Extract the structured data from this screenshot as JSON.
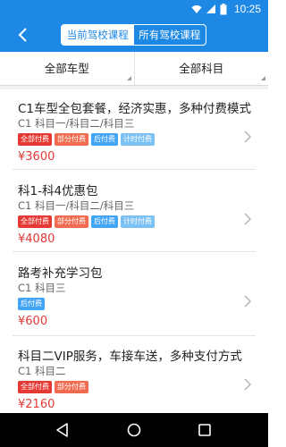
{
  "status_bar": {
    "time": "10:25"
  },
  "header": {
    "tabs": [
      {
        "label": "当前驾校课程",
        "active": true
      },
      {
        "label": "所有驾校课程",
        "active": false
      }
    ]
  },
  "filters": {
    "vehicle": "全部车型",
    "subject": "全部科目"
  },
  "courses": [
    {
      "title": "C1车型全包套餐，经济实惠，多种付费模式",
      "subtitle": "C1 科目一/科目二/科目三",
      "tags": [
        {
          "label": "全部付费",
          "color": "#e53935"
        },
        {
          "label": "部分付费",
          "color": "#f06b4f"
        },
        {
          "label": "后付费",
          "color": "#42a5f5"
        },
        {
          "label": "计时付费",
          "color": "#7cc1f3"
        }
      ],
      "price": "¥3600"
    },
    {
      "title": "科1-科4优惠包",
      "subtitle": "C1 科目一/科目二/科目三",
      "tags": [
        {
          "label": "全部付费",
          "color": "#e53935"
        },
        {
          "label": "部分付费",
          "color": "#f06b4f"
        },
        {
          "label": "后付费",
          "color": "#42a5f5"
        },
        {
          "label": "计时付费",
          "color": "#7cc1f3"
        }
      ],
      "price": "¥4080"
    },
    {
      "title": "路考补充学习包",
      "subtitle": "C1 科目三",
      "tags": [
        {
          "label": "后付费",
          "color": "#42a5f5"
        }
      ],
      "price": "¥600"
    },
    {
      "title": "科目二VIP服务，车接车送，多种支付方式",
      "subtitle": "C1 科目二",
      "tags": [
        {
          "label": "全部付费",
          "color": "#e53935"
        },
        {
          "label": "部分付费",
          "color": "#f06b4f"
        }
      ],
      "price": "¥2160"
    }
  ],
  "icons": {
    "back": "arrow-left-icon",
    "wifi": "wifi-icon",
    "signal": "signal-icon",
    "battery": "battery-icon",
    "chevron": "chevron-right-icon",
    "nav_back": "triangle-back-icon",
    "nav_home": "circle-home-icon",
    "nav_recent": "square-recent-icon"
  },
  "colors": {
    "primary": "#1e88e5",
    "price": "#e53935",
    "tag_full": "#e53935",
    "tag_partial": "#f06b4f",
    "tag_post": "#42a5f5",
    "tag_timed": "#7cc1f3"
  }
}
